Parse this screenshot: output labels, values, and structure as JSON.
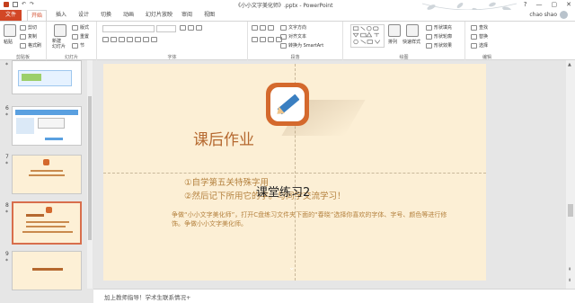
{
  "window": {
    "title": "《小小文字美化师》.pptx - PowerPoint",
    "min": "—",
    "max": "▢",
    "close": "✕",
    "help": "?"
  },
  "quick_access": {
    "undo": "↶",
    "redo": "↷"
  },
  "tabs": [
    "文件",
    "开始",
    "插入",
    "设计",
    "切换",
    "动画",
    "幻灯片放映",
    "审阅",
    "视图"
  ],
  "active_tab": "开始",
  "user": {
    "name": "chao shao"
  },
  "ribbon": {
    "clipboard": {
      "label": "剪贴板",
      "paste": "粘贴",
      "cut": "剪切",
      "copy": "复制",
      "format": "格式刷"
    },
    "slides": {
      "label": "幻灯片",
      "new_slide": "新建\n幻灯片",
      "layout": "版式",
      "reset": "重置",
      "section": "节"
    },
    "font": {
      "label": "字体",
      "font_name": "",
      "font_size": ""
    },
    "paragraph": {
      "label": "段落",
      "text_dir": "文字方向",
      "align_text": "对齐文本",
      "smartart": "转换为 SmartArt"
    },
    "drawing": {
      "label": "绘图",
      "arrange": "排列",
      "quick_styles": "快速样式",
      "fill": "形状填充",
      "outline": "形状轮廓",
      "effects": "形状效果"
    },
    "editing": {
      "label": "编辑",
      "find": "查找",
      "replace": "替换",
      "select": "选择"
    }
  },
  "thumbnails": [
    {
      "num": "5",
      "star": "*"
    },
    {
      "num": "6",
      "star": "*"
    },
    {
      "num": "7",
      "star": "*"
    },
    {
      "num": "8",
      "star": "*"
    },
    {
      "num": "9",
      "star": "*"
    }
  ],
  "slide": {
    "title": "课后作业",
    "overlay": "课堂练习2",
    "line1": "①自学第五关特殊字用",
    "line2": "②然后记下所用它的字。与同学交流学习！",
    "paragraph": "争做“小小文字美化师”，打开C盘练习文件夹下面的“春晓”选择你喜欢的字体、字号、颜色等进行修饰。争做小小文字美化师。",
    "chevron": "⌄"
  },
  "notes": {
    "placeholder": "加上教师指导！学术生联系情况+"
  },
  "colors": {
    "accent": "#d24726",
    "slide_bg": "#fcefd5",
    "title": "#b5682f",
    "body": "#b5823f"
  }
}
